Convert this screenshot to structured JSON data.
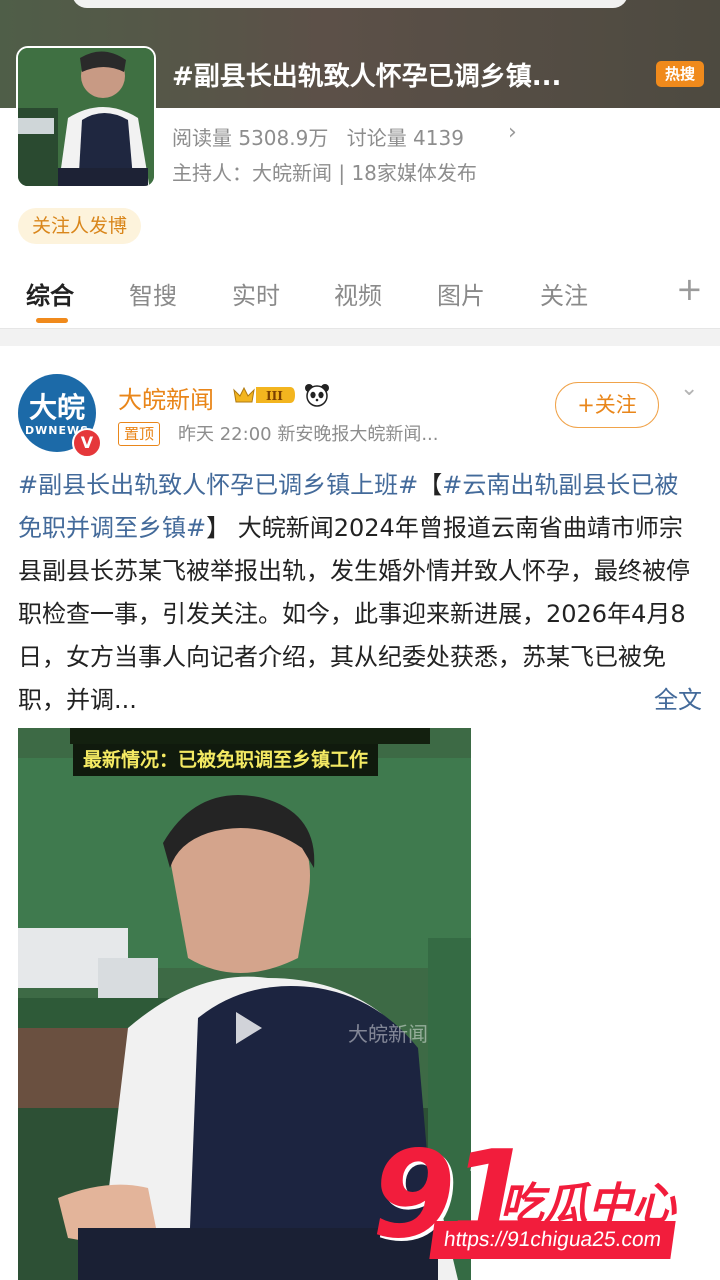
{
  "topic": {
    "title": "#副县长出轨致人怀孕已调乡镇...",
    "hot_badge": "热搜",
    "reads": "阅读量 5308.9万",
    "discussions": "讨论量 4139",
    "host": "主持人：大皖新闻 | 18家媒体发布",
    "follower_chip": "关注人发博"
  },
  "tabs": [
    {
      "label": "综合",
      "active": true
    },
    {
      "label": "智搜"
    },
    {
      "label": "实时"
    },
    {
      "label": "视频"
    },
    {
      "label": "图片"
    },
    {
      "label": "关注"
    }
  ],
  "post": {
    "avatar_text": "大皖",
    "avatar_subtext": "DWNEWS",
    "verified": "V",
    "author": "大皖新闻",
    "crown_badge": "III",
    "pin_tag": "置顶",
    "meta": "昨天 22:00  新安晚报大皖新闻...",
    "follow_button": "+关注",
    "text_topic_1": "#副县长出轨致人怀孕已调乡镇上班#",
    "text_bracket_open": "【",
    "text_topic_2": "#云南出轨副县长已被免职并调至乡镇#",
    "text_bracket_close": "】",
    "text_body": "大皖新闻2024年曾报道云南省曲靖市师宗县副县长苏某飞被举报出轨，发生婚外情并致人怀孕，最终被停职检查一事，引发关注。如今，此事迎来新进展，2026年4月8日，女方当事人向记者介绍，其从纪委处获悉，苏某飞已被免职，并调...",
    "more_link": "全文"
  },
  "media": {
    "caption_banner": "最新情况：已被免职调至乡镇工作",
    "watermark": "大皖新闻"
  },
  "overlay": {
    "number": "91",
    "brand": "吃瓜中心",
    "url": "https://91chigua25.com"
  },
  "colors": {
    "accent_orange": "#e9861a",
    "link_blue": "#436a9a",
    "watermark_red": "#f21d3c"
  }
}
